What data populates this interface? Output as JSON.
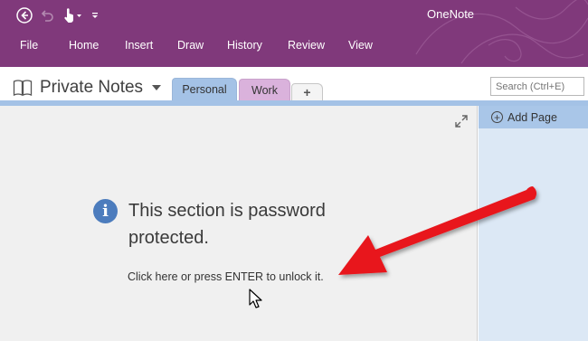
{
  "window": {
    "title": "OneNote"
  },
  "quick_access": {
    "icons": [
      "back-icon",
      "undo-icon",
      "touch-mode-icon",
      "customize-icon"
    ]
  },
  "ribbon": {
    "tabs": [
      {
        "label": "File"
      },
      {
        "label": "Home"
      },
      {
        "label": "Insert"
      },
      {
        "label": "Draw"
      },
      {
        "label": "History"
      },
      {
        "label": "Review"
      },
      {
        "label": "View"
      }
    ]
  },
  "notebook": {
    "name": "Private Notes",
    "sections": [
      {
        "label": "Personal",
        "color": "#a4c2e6",
        "active": true
      },
      {
        "label": "Work",
        "color": "#dab2dc",
        "active": false
      },
      {
        "label": "+"
      }
    ]
  },
  "search": {
    "placeholder": "Search (Ctrl+E)"
  },
  "content": {
    "message": "This section is password protected.",
    "unlock_text": "Click here or press ENTER to unlock it."
  },
  "page_pane": {
    "add_page_label": "Add Page"
  },
  "colors": {
    "title_bar": "#80397b",
    "annotation_arrow": "#e8151b",
    "info_icon": "#4c7cbd"
  }
}
